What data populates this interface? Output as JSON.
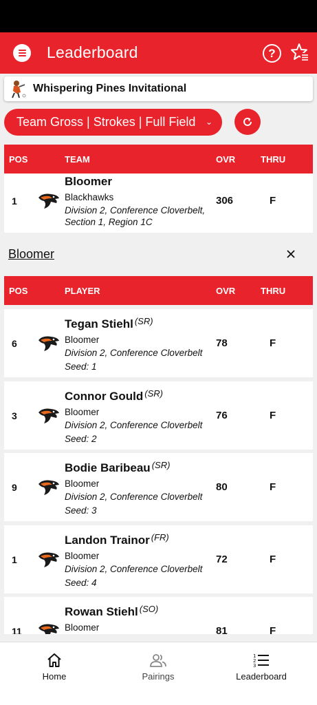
{
  "header": {
    "title": "Leaderboard"
  },
  "tournament": {
    "name": "Whispering Pines Invitational"
  },
  "filter": {
    "label": "Team Gross | Strokes | Full Field"
  },
  "team_table": {
    "columns": [
      "POS",
      "TEAM",
      "OVR",
      "THRU"
    ],
    "rows": [
      {
        "pos": "1",
        "name": "Bloomer",
        "mascot": "Blackhawks",
        "division_line1": "Division 2, Conference Cloverbelt,",
        "division_line2": "Section 1, Region 1C",
        "ovr": "306",
        "thru": "F"
      }
    ]
  },
  "selected_team": {
    "name": "Bloomer"
  },
  "player_table": {
    "columns": [
      "POS",
      "PLAYER",
      "OVR",
      "THRU"
    ],
    "rows": [
      {
        "pos": "6",
        "name": "Tegan Stiehl",
        "year": "(SR)",
        "school": "Bloomer",
        "division": "Division 2, Conference Cloverbelt",
        "seed": "Seed: 1",
        "ovr": "78",
        "thru": "F"
      },
      {
        "pos": "3",
        "name": "Connor Gould",
        "year": "(SR)",
        "school": "Bloomer",
        "division": "Division 2, Conference Cloverbelt",
        "seed": "Seed: 2",
        "ovr": "76",
        "thru": "F"
      },
      {
        "pos": "9",
        "name": "Bodie Baribeau",
        "year": "(SR)",
        "school": "Bloomer",
        "division": "Division 2, Conference Cloverbelt",
        "seed": "Seed: 3",
        "ovr": "80",
        "thru": "F"
      },
      {
        "pos": "1",
        "name": "Landon Trainor",
        "year": "(FR)",
        "school": "Bloomer",
        "division": "Division 2, Conference Cloverbelt",
        "seed": "Seed: 4",
        "ovr": "72",
        "thru": "F"
      },
      {
        "pos": "11",
        "name": "Rowan Stiehl",
        "year": "(SO)",
        "school": "Bloomer",
        "division": "",
        "seed": "",
        "ovr": "81",
        "thru": "F"
      }
    ]
  },
  "bottom_nav": {
    "home": "Home",
    "pairings": "Pairings",
    "leaderboard": "Leaderboard"
  },
  "colors": {
    "accent": "#e8232b",
    "status_bar": "#000000"
  },
  "icons": [
    "menu-icon",
    "help-icon",
    "favorite-star-icon",
    "refresh-icon",
    "close-icon",
    "home-icon",
    "pairings-icon",
    "leaderboard-icon",
    "hawk-logo-icon"
  ]
}
